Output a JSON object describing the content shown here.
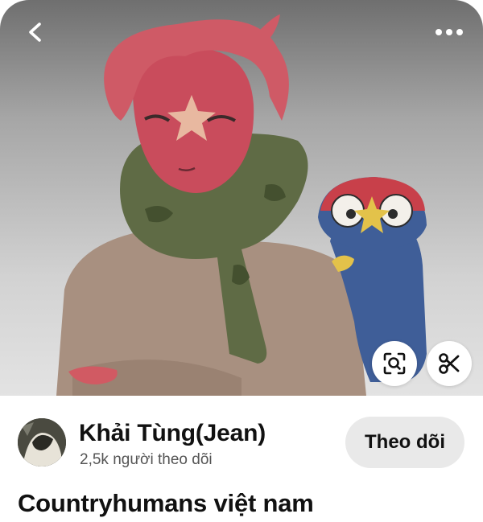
{
  "creator": {
    "name": "Khải Tùng(Jean)",
    "followers": "2,5k người theo dõi",
    "follow_label": "Theo dõi"
  },
  "pin": {
    "title": "Countryhumans việt nam"
  },
  "icons": {
    "back": "chevron-left-icon",
    "more": "more-horizontal-icon",
    "lens": "visual-search-icon",
    "cut": "scissors-icon"
  },
  "colors": {
    "follow_button_bg": "#e9e9e9",
    "text_primary": "#111111",
    "text_secondary": "#555555"
  }
}
